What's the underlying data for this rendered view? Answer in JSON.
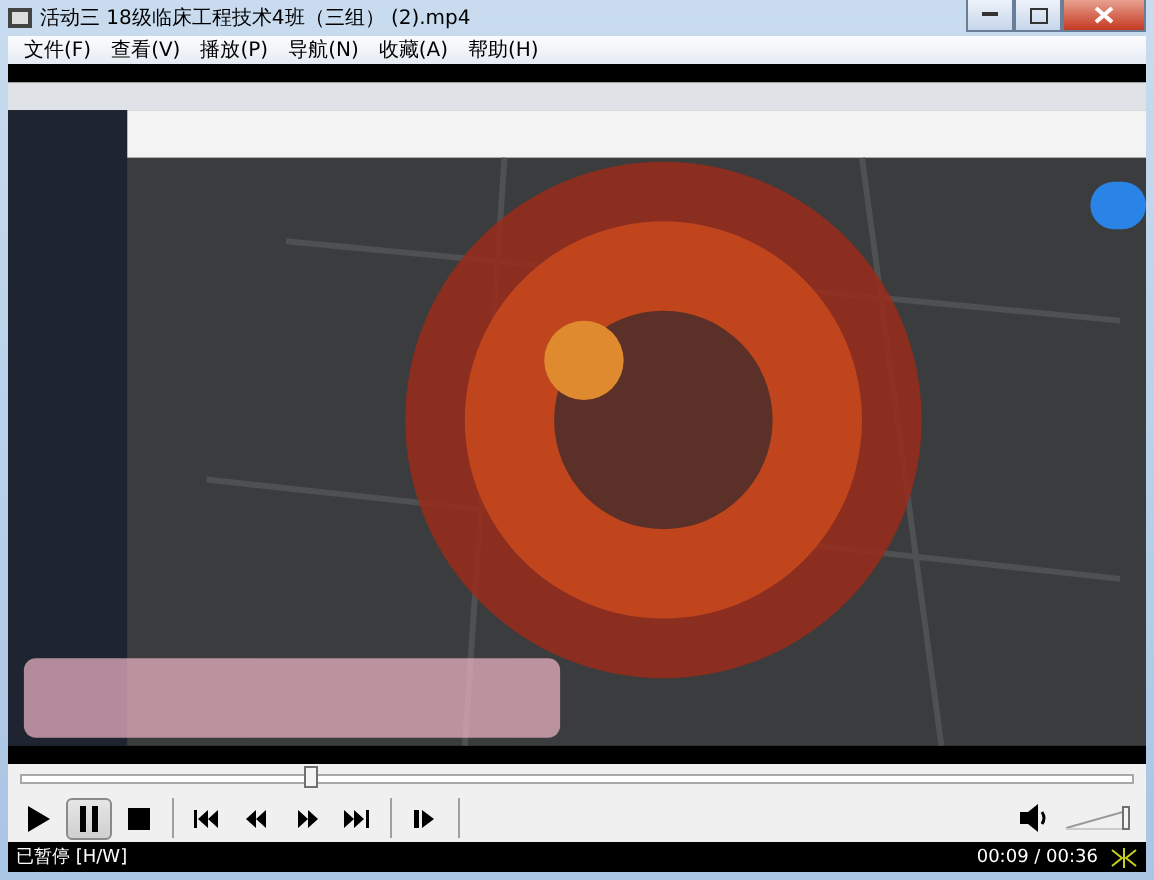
{
  "window": {
    "title": "活动三 18级临床工程技术4班（三组） (2).mp4"
  },
  "menu": [
    "文件(F)",
    "查看(V)",
    "播放(P)",
    "导航(N)",
    "收藏(A)",
    "帮助(H)"
  ],
  "seek": {
    "level": 0.26
  },
  "controls": [
    {
      "kind": "play",
      "selected": false
    },
    {
      "kind": "pause",
      "selected": true
    },
    {
      "kind": "stop",
      "selected": false
    },
    {
      "kind": "sep"
    },
    {
      "kind": "prev",
      "selected": false
    },
    {
      "kind": "rewind",
      "selected": false
    },
    {
      "kind": "forward",
      "selected": false
    },
    {
      "kind": "next",
      "selected": false
    },
    {
      "kind": "sep"
    },
    {
      "kind": "step",
      "selected": false
    },
    {
      "kind": "sep"
    }
  ],
  "volume": {
    "level": 1.0
  },
  "status": {
    "text": "已暂停 [H/W]",
    "time": "00:09 / 00:36"
  }
}
